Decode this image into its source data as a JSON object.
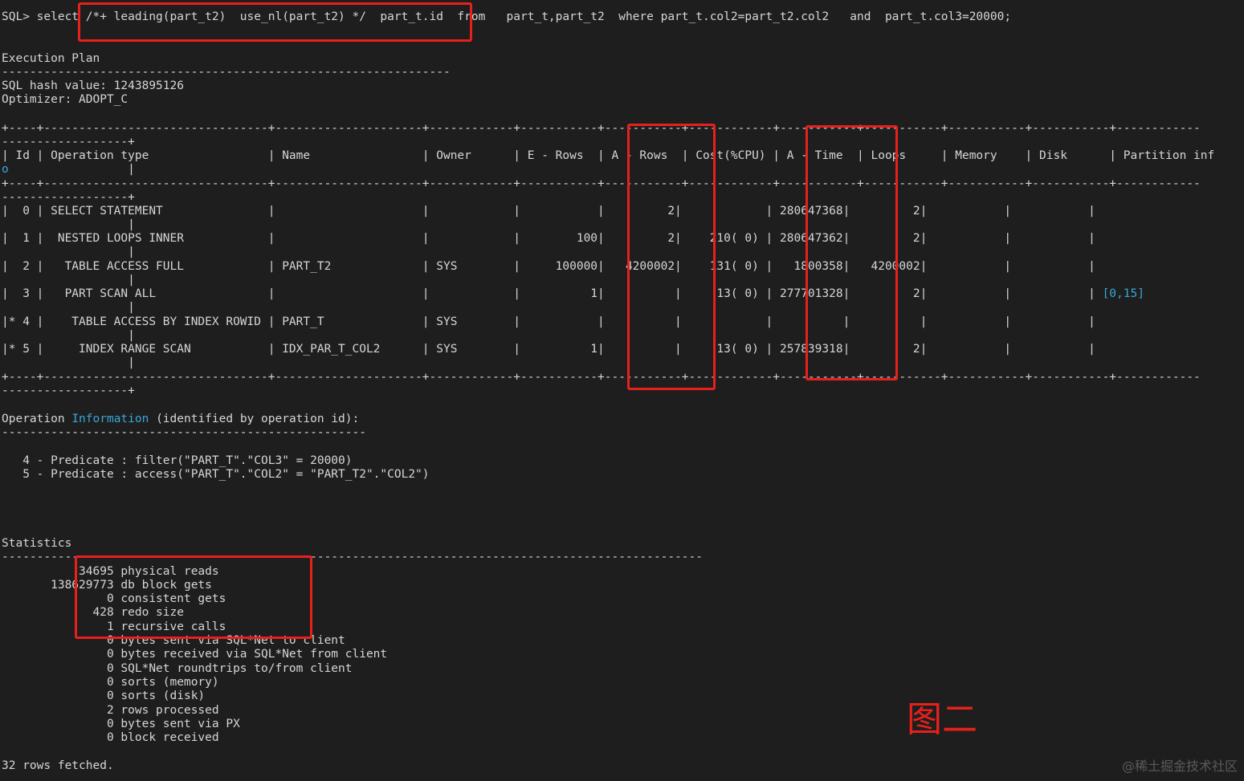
{
  "window": {
    "sql_line": "SQL> select /*+ leading(part_t2)  use_nl(part_t2) */  part_t.id  from   part_t,part_t2  where part_t.col2=part_t2.col2   and  part_t.col3=20000;",
    "figure_label": "图二",
    "watermark": "@稀土掘金技术社区"
  },
  "plan_header": {
    "title": "Execution Plan",
    "rule": "----------------------------------------------------------------",
    "hash": "SQL hash value: 1243895126",
    "optimizer": "Optimizer: ADOPT_C"
  },
  "plan_table": {
    "border_top_a": "+----+--------------------------------+---------------------+------------+-----------+-----------+------------+-----------+-----------+-----------+-----------+------------",
    "border_top_b": "------------------+",
    "header_a": "| Id | Operation type                 | Name                | Owner      | E - Rows  | A - Rows  | Cost(%CPU) | A - Time  | Loops     | Memory    | Disk      | Partition inf",
    "header_b_prefix": "o",
    "header_b_suffix": "                  |",
    "border_mid_a": "+----+--------------------------------+---------------------+------------+-----------+-----------+------------+-----------+-----------+-----------+-----------+------------",
    "border_mid_b": "------------------+",
    "rows": [
      {
        "text": "|  0 | SELECT STATEMENT               |                     |            |           |         2|            | 280647368|         2|           |           |",
        "partition": "",
        "cont": "                  |"
      },
      {
        "text": "|  1 |  NESTED LOOPS INNER            |                     |            |        100|         2|    210( 0) | 280647362|         2|           |           |",
        "partition": "",
        "cont": "                  |"
      },
      {
        "text": "|  2 |   TABLE ACCESS FULL            | PART_T2             | SYS        |     100000|   4200002|    131( 0) |   1800358|   4200002|           |           |",
        "partition": "",
        "cont": "                  |"
      },
      {
        "text": "|  3 |   PART SCAN ALL                |                     |            |          1|          |     13( 0) | 277701328|         2|           |           | ",
        "partition": "[0,15]",
        "cont": "                  |"
      },
      {
        "text": "|* 4 |    TABLE ACCESS BY INDEX ROWID | PART_T              | SYS        |           |          |            |          |          |           |           |",
        "partition": "",
        "cont": "                  |"
      },
      {
        "text": "|* 5 |     INDEX RANGE SCAN           | IDX_PAR_T_COL2      | SYS        |          1|          |     13( 0) | 257839318|         2|           |           |",
        "partition": "",
        "cont": "                  |"
      }
    ],
    "border_bot_a": "+----+--------------------------------+---------------------+------------+-----------+-----------+------------+-----------+-----------+-----------+-----------+------------",
    "border_bot_b": "------------------+"
  },
  "operation_info": {
    "title_pre": "Operation ",
    "title_hl": "Information",
    "title_post": " (identified by operation id):",
    "rule": "----------------------------------------------------",
    "pred4": "   4 - Predicate : filter(\"PART_T\".\"COL3\" = 20000)",
    "pred5": "   5 - Predicate : access(\"PART_T\".\"COL2\" = \"PART_T2\".\"COL2\")"
  },
  "statistics": {
    "title": "Statistics",
    "rule": "----------------------------------------------------------------------------------------------------",
    "items": [
      "           34695 physical reads",
      "       138629773 db block gets",
      "               0 consistent gets",
      "             428 redo size",
      "               1 recursive calls",
      "               0 bytes sent via SQL*Net to client",
      "               0 bytes received via SQL*Net from client",
      "               0 SQL*Net roundtrips to/from client",
      "               0 sorts (memory)",
      "               0 sorts (disk)",
      "               2 rows processed",
      "               0 bytes sent via PX",
      "               0 block received"
    ]
  },
  "footer": "32 rows fetched.",
  "colors": {
    "background": "#1e1e1e",
    "text": "#d6d6d6",
    "highlight": "#3aa6d6",
    "annotation_red": "#e8201c"
  }
}
